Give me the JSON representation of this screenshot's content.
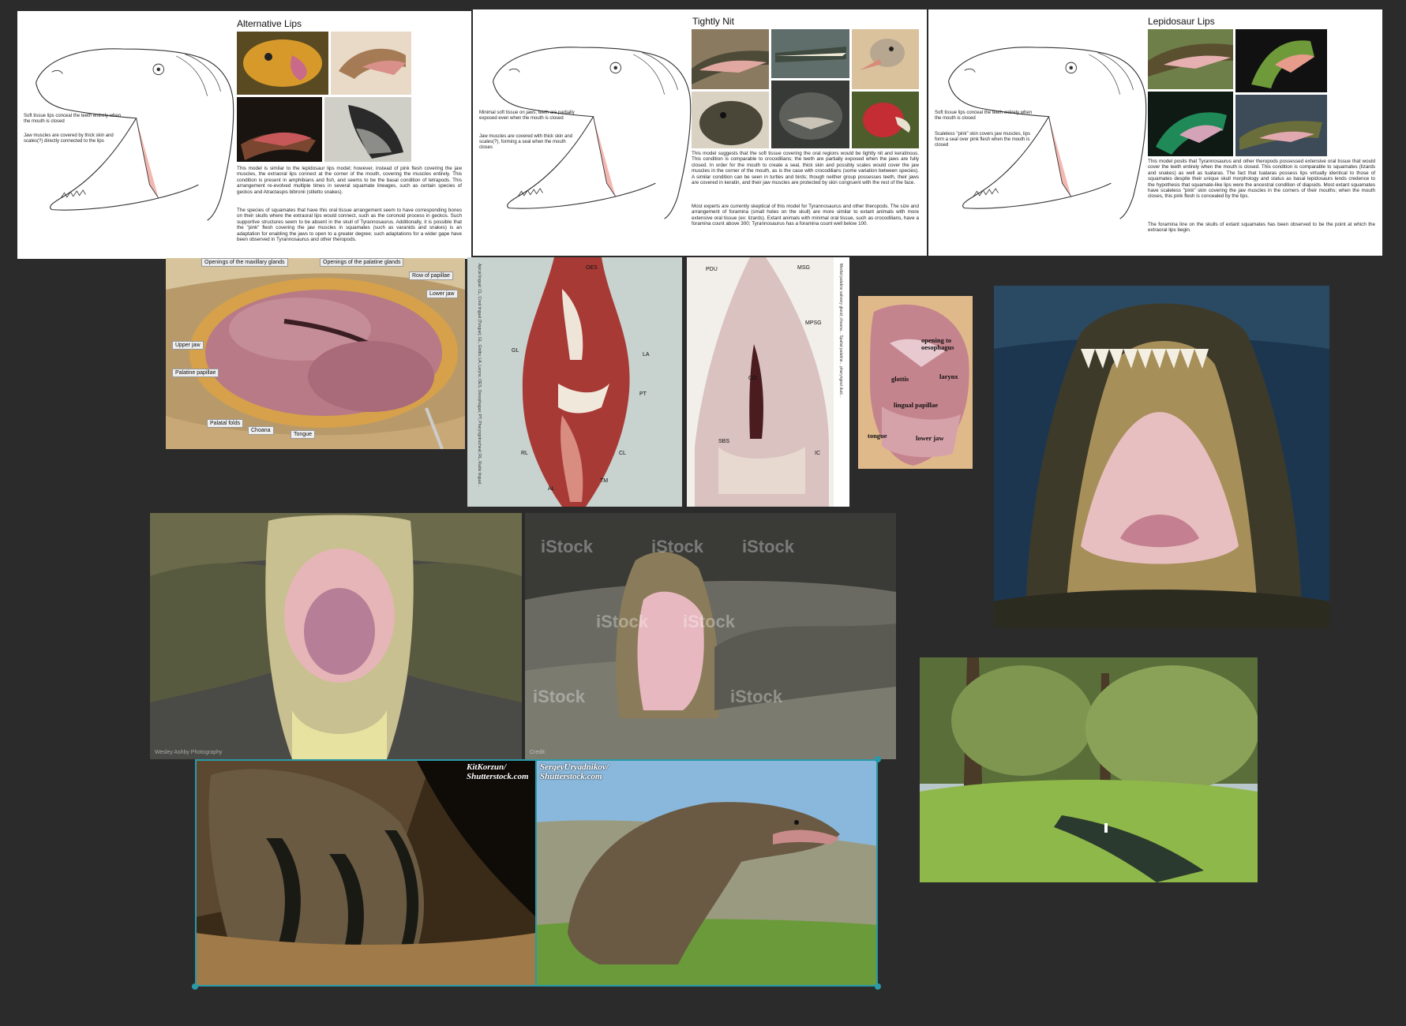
{
  "slides": {
    "alternative": {
      "title": "Alternative Lips",
      "caption_1": "Soft tissue lips conceal the teeth entirely when the mouth is closed",
      "caption_2": "Jaw muscles are covered by thick skin and scales(?) directly connected to the lips",
      "para_1": "This model is similar to the lepidosaur lips model; however, instead of pink flesh covering the jaw muscles, the extraoral lips connect at the corner of the mouth, covering the muscles entirely. This condition is present in amphibians and fish, and seems to be the basal condition of tetrapods. This arrangement re-evolved multiple times in several squamate lineages, such as certain species of geckos and Atractaspis bibronii (stiletto snakes).",
      "para_2": "The species of squamates that have this oral tissue arrangement seem to have corresponding bones on their skulls where the extraoral lips would connect, such as the coronoid process in geckos. Such supportive structures seem to be absent in the skull of Tyrannosaurus. Additionally, it is possible that the \"pink\" flesh covering the jaw muscles in squamates (such as varanids and snakes) is an adaptation for enabling the jaws to open to a greater degree; such adaptations for a wider gape have been observed in Tyrannosaurus and other theropods."
    },
    "tightly": {
      "title": "Tightly Nit",
      "caption_1": "Minimal soft tissue on jaws, teeth are partially exposed even when the mouth is closed",
      "caption_2": "Jaw muscles are covered with thick skin and scales(?), forming a seal when the mouth closes",
      "para_1": "This model suggests that the soft tissue covering the oral regions would be tightly nit and keratinous. This condition is comparable to crocodilians; the teeth are partially exposed when the jaws are fully closed. In order for the mouth to create a seal, thick skin and possibly scales would cover the jaw muscles in the corner of the mouth, as is the case with crocodilians (some variation between species). A similar condition can be seen in turtles and birds; though neither group possesses teeth, their jaws are covered in keratin, and their jaw muscles are protected by skin congruent with the rest of the face.",
      "para_2": "Most experts are currently skeptical of this model for Tyrannosaurus and other theropods. The size and arrangement of foramina (small holes on the skull) are more similar to extant animals with more extensive oral tissue (ex: lizards). Extant animals with minimal oral tissue, such as crocodilians, have a foramina count above 300; Tyrannosaurus has a foramina count well below 100."
    },
    "lepidosaur": {
      "title": "Lepidosaur Lips",
      "caption_1": "Soft tissue lips conceal the teeth entirely when the mouth is closed",
      "caption_2": "Scaleless \"pink\" skin covers jaw muscles, lips form a seal over pink flesh when the mouth is closed",
      "para_1": "This model posits that Tyrannosaurus and other theropods possessed extensive oral tissue that would cover the teeth entirely when the mouth is closed. This condition is comparable to squamates (lizards and snakes) as well as tuataras. The fact that tuataras possess lips virtually identical to those of squamates despite their unique skull morphology and status as basal lepidosaurs lends credence to the hypothesis that squamate-like lips were the ancestral condition of diapsids. Most extant squamates have scaleless \"pink\" skin covering the jaw muscles in the corners of their mouths; when the mouth closes, this pink flesh is concealed by the lips.",
      "para_2": "The foramina line on the skulls of extant squamates has been observed to be the point at which the extraoral lips begin."
    }
  },
  "anatomy_photo": {
    "labels": {
      "maxillary": "Openings of the maxillary glands",
      "palatine_glands": "Openings of the palatine glands",
      "row_papillae": "Row of papillae",
      "lower_jaw": "Lower jaw",
      "upper_jaw": "Upper jaw",
      "palatine_papillae": "Palatine papillae",
      "palatal_folds": "Palatal folds",
      "choana": "Choana",
      "tongue": "Tongue"
    }
  },
  "dissection_1": {
    "labels": {
      "oes": "OES",
      "gl": "GL",
      "la": "LA",
      "pt": "PT",
      "rl": "RL",
      "cl": "CL",
      "al": "AL",
      "tm": "TM"
    },
    "legend": "Apical lingual: CL, Crest lingual (Tongue); GL, Glottis; LA, Larynx; OES, Oesophagus; PT, Pharyngotracheal; RL, Radix lingual..."
  },
  "dissection_2": {
    "labels": {
      "pdu": "PDU",
      "msg": "MSG",
      "mpsg": "MPSG",
      "co": "CO",
      "sbs": "SBS",
      "ic": "IC"
    },
    "legend": "Medial palatine salivary gland; choana... Spatial palatine... pharyngeal duct..."
  },
  "larynx_photo": {
    "labels": {
      "opening": "opening to oesophagus",
      "glottis": "glottis",
      "larynx": "larynx",
      "lingual": "lingual papillae",
      "tongue": "tongue",
      "lower_jaw": "lower jaw"
    }
  },
  "croc_photo_1": {
    "credit": "Wesley Ashby Photography"
  },
  "croc_photo_2": {
    "watermark": "iStock",
    "credit": "Credit:"
  },
  "selected_photos": {
    "left_credit": "KitKorzun/ Shutterstock.com",
    "right_credit": "SergeyUryadnikov/ Shutterstock.com"
  },
  "colors": {
    "selection": "#2a9aa8",
    "canvas": "#2b2b2b"
  }
}
